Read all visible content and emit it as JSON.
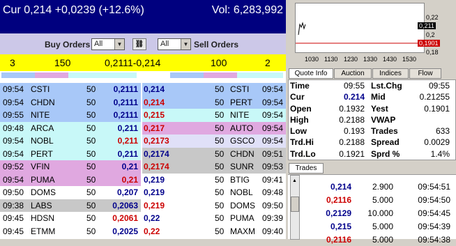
{
  "header": {
    "cur": "Cur 0,214 +0,0239 (+12.6%)",
    "vol": "Vol: 6,283,992"
  },
  "controls": {
    "buy_label": "Buy Orders",
    "buy_filter": "All",
    "sell_filter": "All",
    "sell_label": "Sell Orders"
  },
  "summary": {
    "buy_count": "3",
    "buy_size": "150",
    "spread": "0,2111-0,214",
    "sell_size": "100",
    "sell_count": "2"
  },
  "colors": {
    "blue": "#a8c8f8",
    "cyan": "#c8f8f8",
    "pink": "#e0a8e0",
    "grey": "#c8c8c8",
    "lavender": "#e0e0f8",
    "white": "#ffffff"
  },
  "bids": [
    {
      "time": "09:54",
      "mm": "CSTI",
      "size": "50",
      "price": "0,2111",
      "bg": "blue",
      "pc": "#00008b"
    },
    {
      "time": "09:54",
      "mm": "CHDN",
      "size": "50",
      "price": "0,2111",
      "bg": "blue",
      "pc": "#00008b"
    },
    {
      "time": "09:55",
      "mm": "NITE",
      "size": "50",
      "price": "0,2111",
      "bg": "blue",
      "pc": "#00008b"
    },
    {
      "time": "09:48",
      "mm": "ARCA",
      "size": "50",
      "price": "0,211",
      "bg": "cyan",
      "pc": "#00008b"
    },
    {
      "time": "09:54",
      "mm": "NOBL",
      "size": "50",
      "price": "0,211",
      "bg": "cyan",
      "pc": "#cc0000"
    },
    {
      "time": "09:54",
      "mm": "PERT",
      "size": "50",
      "price": "0,211",
      "bg": "cyan",
      "pc": "#00008b"
    },
    {
      "time": "09:52",
      "mm": "VFIN",
      "size": "50",
      "price": "0,21",
      "bg": "pink",
      "pc": "#00008b"
    },
    {
      "time": "09:54",
      "mm": "PUMA",
      "size": "50",
      "price": "0,21",
      "bg": "pink",
      "pc": "#cc0000"
    },
    {
      "time": "09:50",
      "mm": "DOMS",
      "size": "50",
      "price": "0,207",
      "bg": "white",
      "pc": "#00008b"
    },
    {
      "time": "09:38",
      "mm": "LABS",
      "size": "50",
      "price": "0,2063",
      "bg": "grey",
      "pc": "#00008b"
    },
    {
      "time": "09:45",
      "mm": "HDSN",
      "size": "50",
      "price": "0,2061",
      "bg": "white",
      "pc": "#cc0000"
    },
    {
      "time": "09:45",
      "mm": "ETMM",
      "size": "50",
      "price": "0,2025",
      "bg": "white",
      "pc": "#00008b"
    }
  ],
  "asks": [
    {
      "price": "0,214",
      "size": "50",
      "mm": "CSTI",
      "time": "09:54",
      "bg": "blue",
      "pc": "#00008b"
    },
    {
      "price": "0,214",
      "size": "50",
      "mm": "PERT",
      "time": "09:54",
      "bg": "blue",
      "pc": "#cc0000"
    },
    {
      "price": "0,215",
      "size": "50",
      "mm": "NITE",
      "time": "09:54",
      "bg": "cyan",
      "pc": "#cc0000"
    },
    {
      "price": "0,217",
      "size": "50",
      "mm": "AUTO",
      "time": "09:54",
      "bg": "pink",
      "pc": "#cc0000"
    },
    {
      "price": "0,2173",
      "size": "50",
      "mm": "GSCO",
      "time": "09:54",
      "bg": "lavender",
      "pc": "#cc0000"
    },
    {
      "price": "0,2174",
      "size": "50",
      "mm": "CHDN",
      "time": "09:51",
      "bg": "grey",
      "pc": "#00008b"
    },
    {
      "price": "0,2174",
      "size": "50",
      "mm": "SUNR",
      "time": "09:53",
      "bg": "grey",
      "pc": "#cc0000"
    },
    {
      "price": "0,219",
      "size": "50",
      "mm": "BTIG",
      "time": "09:41",
      "bg": "white",
      "pc": "#00008b"
    },
    {
      "price": "0,219",
      "size": "50",
      "mm": "NOBL",
      "time": "09:48",
      "bg": "white",
      "pc": "#00008b"
    },
    {
      "price": "0,219",
      "size": "50",
      "mm": "DOMS",
      "time": "09:50",
      "bg": "white",
      "pc": "#cc0000"
    },
    {
      "price": "0,22",
      "size": "50",
      "mm": "PUMA",
      "time": "09:39",
      "bg": "white",
      "pc": "#00008b"
    },
    {
      "price": "0,22",
      "size": "50",
      "mm": "MAXM",
      "time": "09:40",
      "bg": "white",
      "pc": "#cc0000"
    }
  ],
  "chart": {
    "y_ticks": [
      "0,22",
      "0,211",
      "0,2",
      "0,1901",
      "0,18"
    ],
    "x_ticks": [
      "1030",
      "1130",
      "1230",
      "1330",
      "1430",
      "1530"
    ]
  },
  "tabs": [
    "Quote Info",
    "Auction",
    "Indices",
    "Flow"
  ],
  "quote": [
    {
      "l1": "Time",
      "v1": "09:55",
      "l2": "Lst.Chg",
      "v2": "09:55"
    },
    {
      "l1": "Cur",
      "v1": "0.214",
      "l2": "Mid",
      "v2": "0.21255"
    },
    {
      "l1": "Open",
      "v1": "0.1932",
      "l2": "Yest",
      "v2": "0.1901"
    },
    {
      "l1": "High",
      "v1": "0.2188",
      "l2": "VWAP",
      "v2": ""
    },
    {
      "l1": "Low",
      "v1": "0.193",
      "l2": "Trades",
      "v2": "633"
    },
    {
      "l1": "Trd.Hi",
      "v1": "0.2188",
      "l2": "Spread",
      "v2": "0.0029"
    },
    {
      "l1": "Trd.Lo",
      "v1": "0.1921",
      "l2": "Sprd %",
      "v2": "1.4%"
    }
  ],
  "trades_tab": "Trades",
  "trades": [
    {
      "price": "0,214",
      "size": "2.900",
      "time": "09:54:51",
      "pc": "#00008b"
    },
    {
      "price": "0,2116",
      "size": "5.000",
      "time": "09:54:50",
      "pc": "#cc0000"
    },
    {
      "price": "0,2129",
      "size": "10.000",
      "time": "09:54:45",
      "pc": "#00008b"
    },
    {
      "price": "0,215",
      "size": "5.000",
      "time": "09:54:39",
      "pc": "#00008b"
    },
    {
      "price": "0,2116",
      "size": "5.000",
      "time": "09:54:38",
      "pc": "#cc0000"
    }
  ]
}
